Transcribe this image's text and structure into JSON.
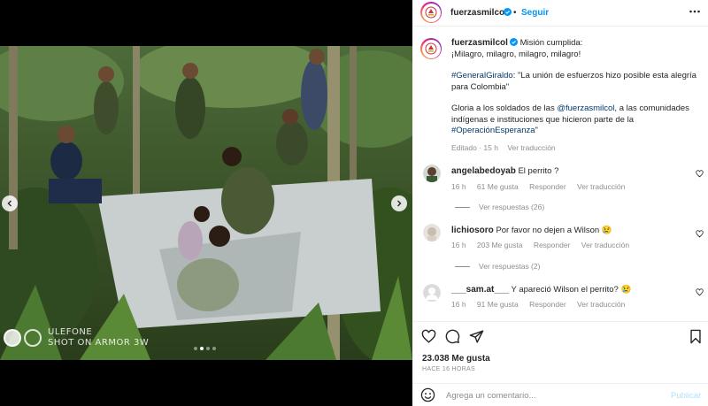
{
  "post": {
    "username": "fuerzasmilcol",
    "separator": "•",
    "follow_label": "Seguir",
    "caption_lines": {
      "line1": "Misión cumplida:",
      "line2": "¡Milagro, milagro, milagro, milagro!",
      "hashtag1": "#GeneralGiraldo",
      "quote": ": \"La unión de esfuerzos hizo posible esta alegría para Colombia\"",
      "p3_start": "Gloria a los soldados de las ",
      "mention": "@fuerzasmilcol",
      "p3_mid": ", a las comunidades indígenas e instituciones que hicieron parte de la",
      "hashtag2": "#OperaciónEsperanza",
      "p3_end": "\""
    },
    "caption_meta": {
      "edited": "Editado · 15 h",
      "see_translation": "Ver traducción"
    },
    "likes": "23.038 Me gusta",
    "time_ago": "HACE 16 HORAS",
    "add_comment_placeholder": "Agrega un comentario...",
    "publish_label": "Publicar"
  },
  "watermark": {
    "line1": "ULEFONE",
    "line2": "SHOT ON ARMOR 3W"
  },
  "comments": [
    {
      "username": "angelabedoyab",
      "text": "El perrito ?",
      "time": "16 h",
      "likes": "61 Me gusta",
      "reply": "Responder",
      "translate": "Ver traducción",
      "replies": "Ver respuestas (26)"
    },
    {
      "username": "lichiosoro",
      "text": "Por favor no dejen a Wilson 😢",
      "time": "16 h",
      "likes": "203 Me gusta",
      "reply": "Responder",
      "translate": "Ver traducción",
      "replies": "Ver respuestas (2)"
    },
    {
      "username": "___sam.at___",
      "text": "Y apareció Wilson el perrito? 😢",
      "time": "16 h",
      "likes": "91 Me gusta",
      "reply": "Responder",
      "translate": "Ver traducción"
    }
  ],
  "icons": {
    "heart": "heart-icon",
    "comment": "comment-icon",
    "share": "share-icon",
    "save": "bookmark-icon",
    "more": "more-icon",
    "emoji": "emoji-icon"
  },
  "colors": {
    "link": "#00376b",
    "follow": "#0095f6",
    "muted": "#8e8e8e"
  }
}
